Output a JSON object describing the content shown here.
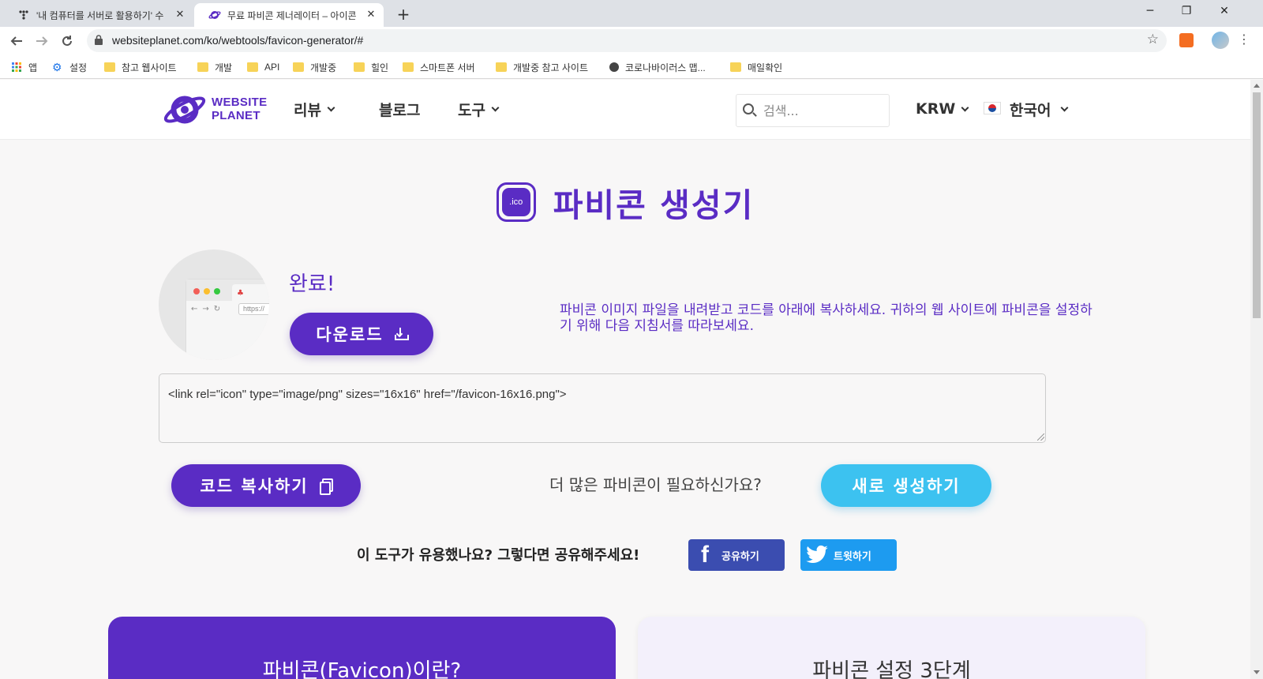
{
  "browser": {
    "tabs": [
      {
        "title": "'내 컴퓨터를 서버로 활용하기' 수",
        "close": "✕"
      },
      {
        "title": "무료 파비콘 제너레이터 – 아이콘",
        "close": "✕"
      }
    ],
    "new_tab": "+",
    "window_controls": {
      "minimize": "─",
      "restore": "❐",
      "close": "✕"
    },
    "url": "websiteplanet.com/ko/webtools/favicon-generator/#",
    "bookmarks": [
      "앱",
      "설정",
      "참고 웹사이트",
      "개발",
      "API",
      "개발중",
      "힐인",
      "스마트폰 서버",
      "개발중 참고 사이트",
      "코로나바이러스 맵...",
      "매일확인"
    ]
  },
  "site": {
    "logo": {
      "line1": "WEBSITE",
      "line2": "PLANET"
    },
    "nav": {
      "reviews": "리뷰",
      "blog": "블로그",
      "tools": "도구"
    },
    "search_placeholder": "검색...",
    "currency": "KRW",
    "language": "한국어"
  },
  "tool": {
    "badge": ".ico",
    "title": "파비콘 생성기",
    "done": "완료!",
    "download_label": "다운로드",
    "preview_url": "https://",
    "instructions": "파비콘 이미지 파일을 내려받고 코드를 아래에 복사하세요. 귀하의 웹 사이트에 파비콘을 설정하기 위해 다음 지침서를 따라보세요.",
    "code": "<link rel=\"icon\" type=\"image/png\" sizes=\"16x16\" href=\"/favicon-16x16.png\">",
    "copy_label": "코드 복사하기",
    "more_question": "더 많은 파비콘이 필요하신가요?",
    "new_label": "새로 생성하기",
    "share_question": "이 도구가 유용했나요? 그렇다면 공유해주세요!",
    "share_fb": "공유하기",
    "share_tw": "트윗하기"
  },
  "cards": {
    "left_title": "파비콘(Favicon)이란?",
    "right_title": "파비콘 설정 3단계"
  },
  "colors": {
    "brand": "#5a2cc4",
    "accent": "#3cc2f0",
    "facebook": "#3b4db0",
    "twitter": "#1d9bf0"
  }
}
